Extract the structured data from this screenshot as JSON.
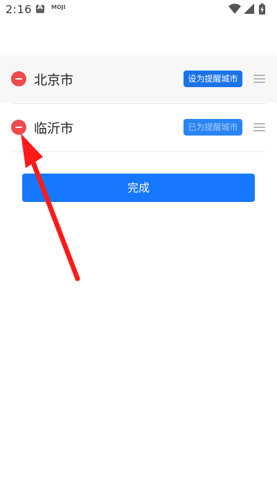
{
  "status_bar": {
    "time": "2:16",
    "app_badge": "MOJI",
    "icons": [
      "android-a-icon",
      "wifi-icon",
      "cellular-signal-icon",
      "battery-charging-icon"
    ]
  },
  "city_list": [
    {
      "name": "北京市",
      "reminder_label": "设为提醒城市",
      "is_reminder": false
    },
    {
      "name": "临沂市",
      "reminder_label": "已为提醒城市",
      "is_reminder": true
    }
  ],
  "done_label": "完成",
  "colors": {
    "primary_blue": "#1677ff",
    "remove_red": "#f04a4a",
    "annotation_arrow": "#ff1a1a"
  }
}
